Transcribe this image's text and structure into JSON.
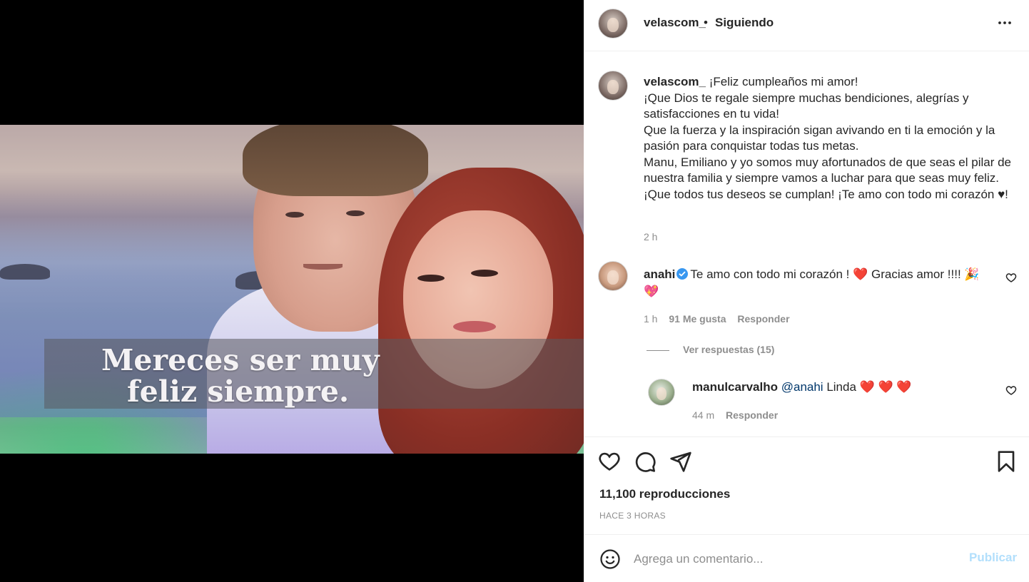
{
  "media": {
    "caption_line1": "Mereces ser muy",
    "caption_line2": "feliz siempre."
  },
  "header": {
    "username": "velascom_",
    "separator": "•",
    "follow_status": "Siguiendo",
    "more_icon": "more-horizontal-icon"
  },
  "post_caption": {
    "username": "velascom_",
    "lines": [
      "¡Feliz cumpleaños mi amor!",
      "¡Que Dios te regale siempre muchas bendiciones, alegrías y satisfacciones en tu vida!",
      "Que la fuerza y la inspiración sigan avivando en ti la emoción y la pasión para conquistar todas tus metas.",
      "Manu, Emiliano y yo somos muy afortunados de que seas el pilar de nuestra familia y siempre vamos a luchar para que seas muy feliz.",
      "¡Que todos tus deseos se cumplan! ¡Te amo con todo mi corazón ♥!"
    ],
    "time": "2 h"
  },
  "comments": [
    {
      "username": "anahi",
      "verified": true,
      "text": "Te amo con todo mi corazón ! ❤️ Gracias amor !!!! 🎉 💖",
      "time": "1 h",
      "likes": "91 Me gusta",
      "reply": "Responder",
      "view_replies": "Ver respuestas (15)"
    },
    {
      "username": "manulcarvalho",
      "mention": "@anahi",
      "text": "Linda ❤️ ❤️ ❤️",
      "time": "44 m",
      "reply": "Responder"
    }
  ],
  "actions": {
    "like_icon": "heart-icon",
    "comment_icon": "comment-icon",
    "share_icon": "send-icon",
    "save_icon": "bookmark-icon",
    "views": "11,100 reproducciones",
    "posted_ago": "HACE 3 HORAS"
  },
  "comment_box": {
    "emoji_icon": "emoji-icon",
    "placeholder": "Agrega un comentario...",
    "publish_label": "Publicar"
  },
  "colors": {
    "text": "#262626",
    "secondary": "#8e8e8e",
    "link": "#00376b",
    "verified": "#3897f0",
    "publish_disabled": "#b2dffc",
    "heart_red": "#ed4956"
  }
}
